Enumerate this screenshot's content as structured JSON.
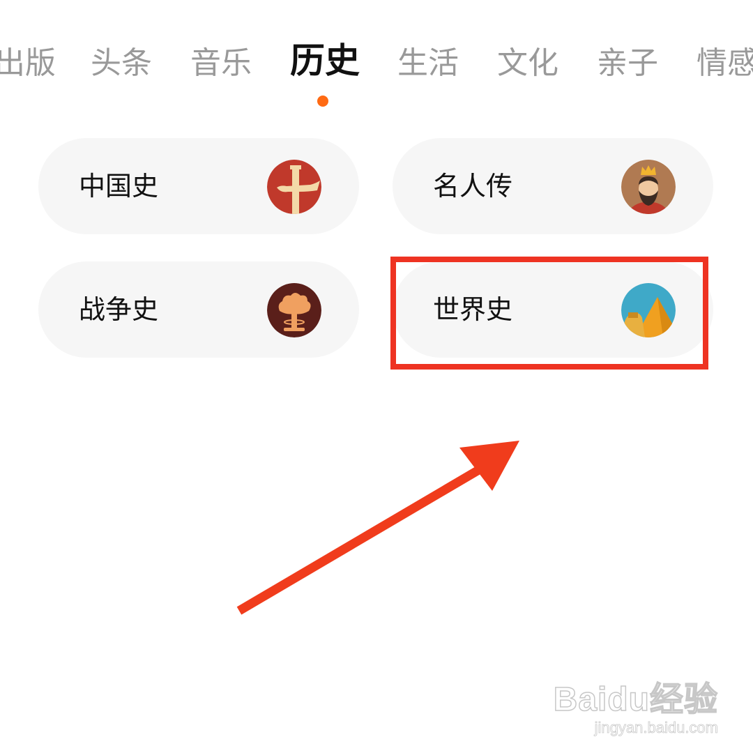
{
  "tabs": [
    {
      "label": "出版",
      "active": false
    },
    {
      "label": "头条",
      "active": false
    },
    {
      "label": "音乐",
      "active": false
    },
    {
      "label": "历史",
      "active": true
    },
    {
      "label": "生活",
      "active": false
    },
    {
      "label": "文化",
      "active": false
    },
    {
      "label": "亲子",
      "active": false
    },
    {
      "label": "情感",
      "active": false
    }
  ],
  "categories": [
    {
      "label": "中国史",
      "icon": "chinese-pillar-icon"
    },
    {
      "label": "名人传",
      "icon": "king-portrait-icon"
    },
    {
      "label": "战争史",
      "icon": "mushroom-cloud-icon"
    },
    {
      "label": "世界史",
      "icon": "pyramid-sphinx-icon"
    }
  ],
  "colors": {
    "accent": "#ff6a13",
    "highlight": "#ee3322",
    "pill_bg": "#f6f6f6",
    "tab_inactive": "#999999",
    "tab_active": "#111111"
  },
  "watermark": {
    "logo": "Baidu经验",
    "url": "jingyan.baidu.com"
  }
}
